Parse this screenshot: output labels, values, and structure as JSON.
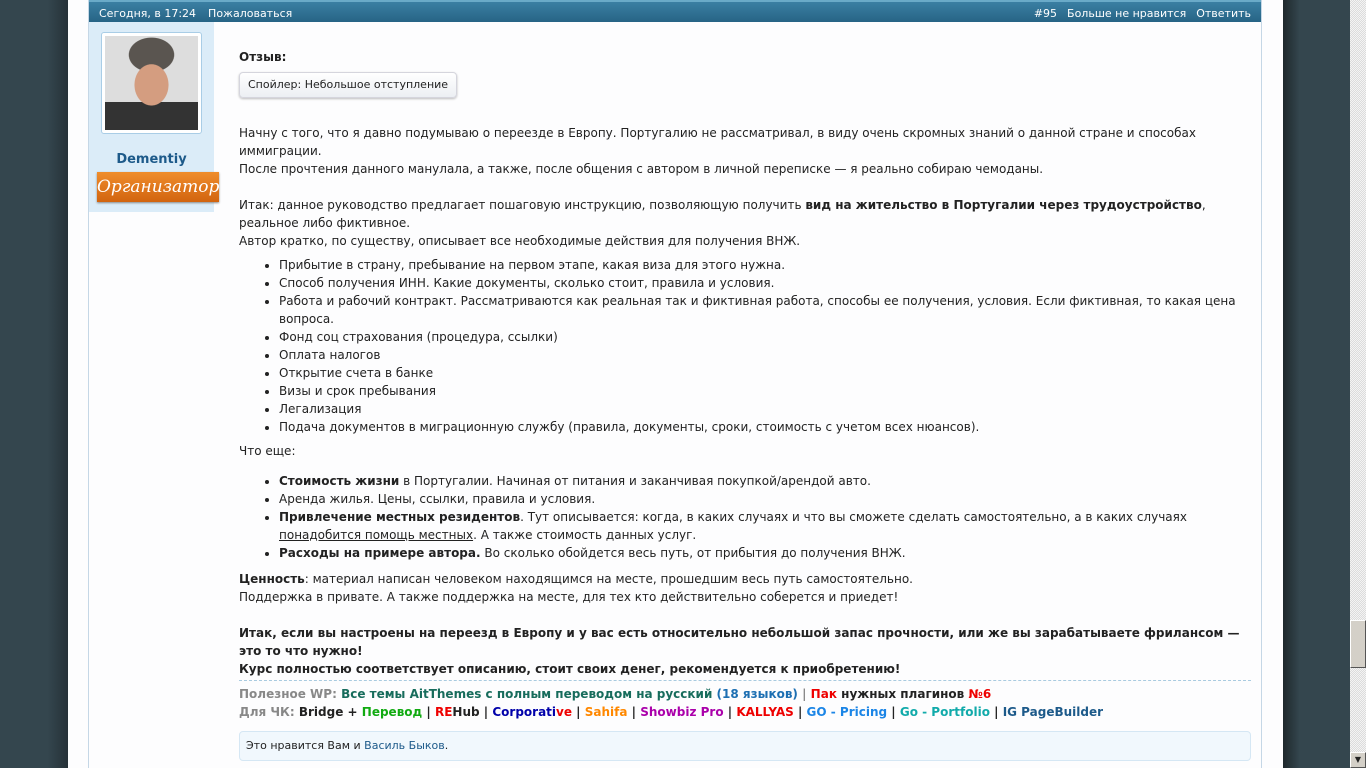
{
  "header": {
    "time": "Сегодня, в 17:24",
    "report": "Пожаловаться",
    "post_number": "#95",
    "unlike": "Больше не нравится",
    "reply": "Ответить"
  },
  "user": {
    "name": "Dementiy",
    "badge": "Организатор"
  },
  "post": {
    "review_label": "Отзыв:",
    "spoiler": "Спойлер: Небольшое отступление",
    "p1": "Начну с того, что я давно подумываю о переезде в Европу. Португалию не рассматривал, в виду очень скромных знаний о данной стране и способах иммиграции.",
    "p2": "После прочтения данного манулала, а также, после общения с автором в личной переписке — я реально собираю чемоданы.",
    "p3a": "Итак: данное руководство предлагает пошаговую инструкцию, позволяющую получить ",
    "p3b": "вид на жительство в Португалии через трудоустройство",
    "p3c": ", реальное либо фиктивное.",
    "p4": "Автор кратко, по существу, описывает все необходимые действия для получения ВНЖ.",
    "list1": [
      "Прибытие в страну, пребывание на первом этапе, какая виза для этого нужна.",
      "Способ получения ИНН. Какие документы, сколько стоит, правила и условия.",
      "Работа и рабочий контракт. Рассматриваются как реальная так и фиктивная работа, способы ее получения, условия. Если фиктивная, то какая цена вопроса.",
      "Фонд соц страхования (процедура, ссылки)",
      "Оплата налогов",
      "Открытие счета в банке",
      "Визы и срок пребывания",
      "Легализация",
      "Подача документов в миграционную службу (правила, документы, сроки, стоимость с учетом всех нюансов)."
    ],
    "what_else": "Что еще:",
    "l2a_b": "Стоимость жизни",
    "l2a": " в Португалии. Начиная от питания и заканчивая покупкой/арендой авто.",
    "l2b": "Аренда жилья. Цены, ссылки, правила и условия.",
    "l2c_b": "Привлечение местных резидентов",
    "l2c": ". Тут описывается: когда, в каких случаях и что вы сможете сделать самостоятельно, а в каких случаях",
    "l2c_u": " понадобится помощь местных",
    "l2c_end": ". А также стоимость данных услуг.",
    "l2d_b": "Расходы на примере автора.",
    "l2d": " Во сколько обойдется весь путь, от прибытия до получения ВНЖ.",
    "v_b": "Ценность",
    "v": ": материал написан человеком находящимся на месте, прошедшим весь путь самостоятельно.",
    "support": "Поддержка в привате. А также поддержка на месте, для тех кто действительно соберется и приедет!",
    "final1": "Итак, если вы настроены на переезд в Европу и у вас есть относительно небольшой запас прочности, или же вы зарабатываете фрилансом — это то что нужно!",
    "final2": "Курс полностью соответствует описанию, стоит своих денег, рекомендуется к приобретению!"
  },
  "signature": {
    "wp_label": "Полезное WP:",
    "wp_link": "Все темы AitThemes с полным переводом на русский",
    "wp_count": " (18 языков)",
    "pack": "Пак",
    "pack_rest": " нужных плагинов ",
    "pack_num": "№6",
    "ck_label": "Для ЧК:",
    "bridge": "Bridge",
    "plus": " + ",
    "perevod": "Перевод",
    "re": "RE",
    "hub": "Hub",
    "corporati": "Corporati",
    "ve": "ve",
    "sahifa": "Sahifa",
    "showbiz": "Showbiz Pro",
    "kallyas": "KALLYAS",
    "gopricing": "GO - Pricing",
    "goportfolio": "Go - Portfolio",
    "ig": "IG PageBuilder",
    "sep": " | "
  },
  "likes": {
    "prefix": "Это нравится Вам и ",
    "user": "Василь Быков",
    "suffix": "."
  }
}
